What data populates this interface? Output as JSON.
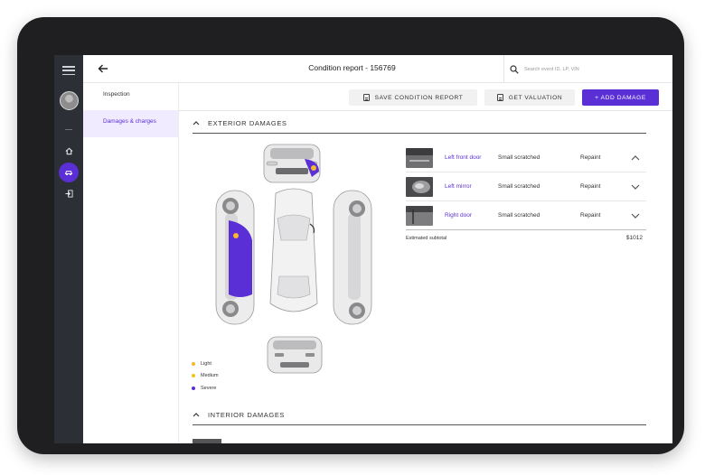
{
  "header": {
    "title": "Condition report - 156769",
    "search_placeholder": "Search event ID, LP, VIN"
  },
  "subnav": {
    "items": [
      {
        "label": "Inspection",
        "active": false
      },
      {
        "label": "Damages & charges",
        "active": true
      }
    ]
  },
  "actions": {
    "save_label": "SAVE CONDITION REPORT",
    "valuation_label": "GET VALUATION",
    "add_label": "+ ADD DAMAGE"
  },
  "exterior": {
    "title": "EXTERIOR DAMAGES",
    "damages": [
      {
        "part": "Left front door",
        "severity": "Small scratched",
        "action": "Repaint",
        "expanded": true,
        "thumb_icon": "door-photo-icon"
      },
      {
        "part": "Left mirror",
        "severity": "Small scratched",
        "action": "Repaint",
        "expanded": false,
        "thumb_icon": "mirror-photo-icon"
      },
      {
        "part": "Right door",
        "severity": "Small scratched",
        "action": "Repaint",
        "expanded": false,
        "thumb_icon": "door-photo-icon"
      }
    ],
    "subtotal_label": "Estimated subtotal",
    "subtotal_value": "$1012"
  },
  "legend": [
    {
      "label": "Light",
      "color": "#f5b82e"
    },
    {
      "label": "Medium",
      "color": "#f0c419"
    },
    {
      "label": "Severe",
      "color": "#5b2fd6"
    }
  ],
  "interior": {
    "title": "INTERIOR DAMAGES"
  },
  "colors": {
    "accent": "#5b2fd6",
    "rail": "#2c2f36",
    "frame": "#1f1f21"
  }
}
